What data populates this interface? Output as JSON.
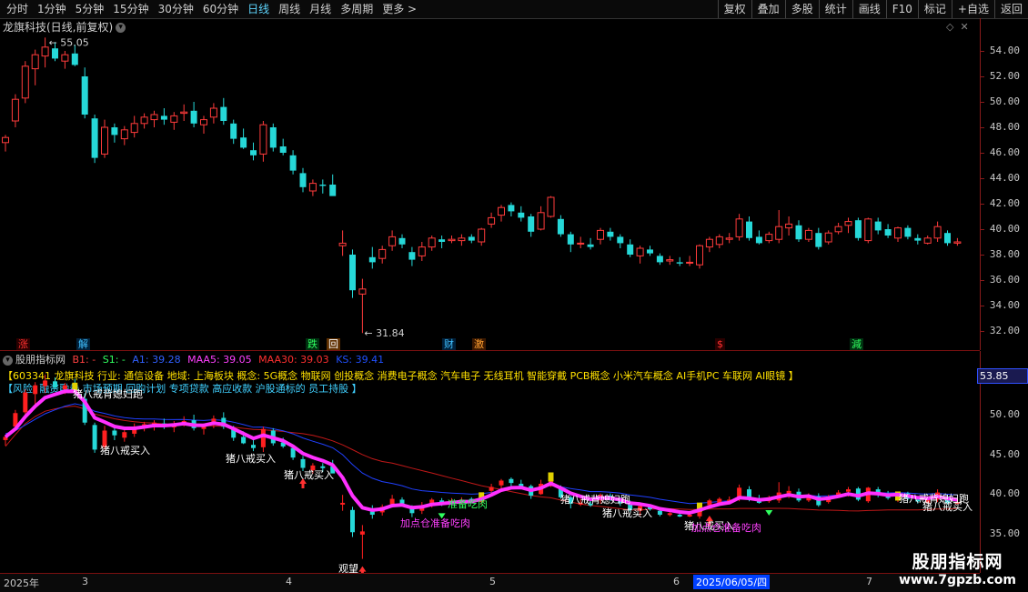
{
  "toolbar": {
    "periods": [
      "分时",
      "1分钟",
      "5分钟",
      "15分钟",
      "30分钟",
      "60分钟",
      "日线",
      "周线",
      "月线",
      "多周期",
      "更多"
    ],
    "active": "日线",
    "more_arrow": ">",
    "actions": [
      "复权",
      "叠加",
      "多股",
      "统计",
      "画线",
      "F10",
      "标记",
      "+自选",
      "返回"
    ]
  },
  "main": {
    "title": "龙旗科技(日线,前复权)",
    "high_label": "55.05",
    "low_label": "31.84",
    "yaxis": [
      "54.00",
      "52.00",
      "50.00",
      "48.00",
      "46.00",
      "44.00",
      "42.00",
      "40.00",
      "38.00",
      "36.00",
      "34.00",
      "32.00"
    ],
    "tags": [
      {
        "text": "涨",
        "color": "#ff3030",
        "bg": "#2a0000"
      },
      {
        "text": "解",
        "color": "#40c0ff",
        "bg": "#00203a"
      },
      {
        "text": "跌",
        "color": "#30ff60",
        "bg": "#003010"
      },
      {
        "text": "回",
        "color": "#ffffff",
        "bg": "#603000"
      },
      {
        "text": "财",
        "color": "#40c0ff",
        "bg": "#00203a"
      },
      {
        "text": "激",
        "color": "#ffa030",
        "bg": "#3a1800"
      },
      {
        "text": "$",
        "color": "#ff3030",
        "bg": "#2a0000"
      },
      {
        "text": "減",
        "color": "#30ff60",
        "bg": "#003010"
      }
    ],
    "ohlc": [
      [
        46.8,
        47.4,
        46.1,
        47.2
      ],
      [
        48.5,
        50.6,
        48.0,
        50.2
      ],
      [
        50.3,
        53.2,
        49.9,
        52.8
      ],
      [
        52.6,
        54.1,
        51.3,
        53.7
      ],
      [
        53.6,
        55.05,
        52.7,
        54.3
      ],
      [
        54.2,
        54.7,
        53.2,
        53.4
      ],
      [
        53.2,
        54.0,
        52.6,
        53.7
      ],
      [
        53.8,
        54.5,
        52.8,
        52.9
      ],
      [
        52.0,
        52.7,
        48.7,
        49.0
      ],
      [
        48.7,
        49.0,
        45.2,
        45.6
      ],
      [
        45.9,
        48.6,
        45.6,
        48.0
      ],
      [
        48.0,
        48.3,
        46.8,
        47.4
      ],
      [
        47.1,
        48.1,
        46.6,
        47.8
      ],
      [
        47.6,
        48.9,
        47.2,
        48.3
      ],
      [
        48.3,
        49.1,
        47.9,
        48.8
      ],
      [
        48.6,
        49.3,
        48.0,
        49.0
      ],
      [
        48.9,
        49.5,
        48.2,
        48.6
      ],
      [
        48.4,
        49.2,
        47.8,
        48.9
      ],
      [
        49.1,
        49.8,
        48.5,
        49.2
      ],
      [
        49.3,
        50.0,
        48.0,
        48.3
      ],
      [
        48.2,
        48.9,
        47.5,
        48.6
      ],
      [
        48.8,
        49.9,
        48.3,
        49.5
      ],
      [
        49.6,
        50.3,
        48.2,
        48.5
      ],
      [
        48.3,
        48.6,
        46.7,
        47.1
      ],
      [
        47.2,
        47.9,
        46.3,
        46.4
      ],
      [
        46.2,
        46.8,
        45.4,
        45.8
      ],
      [
        45.9,
        48.5,
        45.3,
        48.2
      ],
      [
        48.0,
        48.3,
        46.1,
        46.4
      ],
      [
        46.5,
        47.1,
        45.8,
        46.0
      ],
      [
        45.8,
        46.2,
        44.3,
        44.6
      ],
      [
        44.4,
        44.8,
        42.9,
        43.3
      ],
      [
        43.0,
        43.9,
        42.6,
        43.6
      ],
      [
        43.5,
        43.9,
        42.8,
        43.4
      ],
      [
        43.5,
        44.3,
        42.9,
        42.6
      ],
      [
        38.7,
        39.9,
        37.9,
        38.9
      ],
      [
        38.0,
        38.4,
        34.6,
        35.2
      ],
      [
        34.9,
        36.1,
        31.84,
        35.3
      ],
      [
        37.8,
        38.6,
        36.9,
        37.4
      ],
      [
        37.7,
        38.7,
        37.3,
        38.4
      ],
      [
        38.7,
        39.9,
        38.3,
        39.4
      ],
      [
        39.3,
        39.6,
        38.5,
        38.8
      ],
      [
        38.2,
        38.6,
        37.1,
        37.6
      ],
      [
        37.9,
        39.0,
        37.5,
        38.6
      ],
      [
        38.6,
        39.5,
        38.3,
        39.3
      ],
      [
        39.2,
        39.5,
        38.5,
        39.0
      ],
      [
        39.1,
        39.5,
        38.9,
        39.2
      ],
      [
        39.1,
        39.6,
        38.7,
        39.3
      ],
      [
        39.4,
        39.6,
        38.9,
        39.1
      ],
      [
        39.0,
        40.1,
        38.7,
        40.0
      ],
      [
        40.4,
        41.3,
        40.1,
        40.9
      ],
      [
        41.1,
        41.9,
        40.6,
        41.7
      ],
      [
        41.9,
        42.1,
        41.0,
        41.4
      ],
      [
        41.3,
        41.8,
        40.6,
        40.9
      ],
      [
        41.0,
        41.2,
        39.4,
        39.8
      ],
      [
        40.0,
        41.8,
        39.9,
        41.3
      ],
      [
        41.0,
        42.6,
        40.9,
        42.5
      ],
      [
        40.8,
        41.1,
        39.4,
        39.6
      ],
      [
        39.6,
        39.8,
        38.2,
        38.8
      ],
      [
        38.9,
        39.4,
        38.5,
        38.9
      ],
      [
        38.8,
        39.3,
        38.4,
        38.6
      ],
      [
        39.2,
        40.1,
        38.8,
        39.9
      ],
      [
        39.8,
        40.1,
        39.1,
        39.4
      ],
      [
        39.4,
        39.6,
        38.5,
        38.9
      ],
      [
        38.8,
        39.2,
        37.8,
        38.0
      ],
      [
        37.9,
        38.7,
        37.3,
        38.5
      ],
      [
        38.4,
        38.7,
        37.9,
        38.1
      ],
      [
        37.9,
        38.1,
        37.2,
        37.4
      ],
      [
        37.5,
        37.9,
        37.2,
        37.6
      ],
      [
        37.4,
        37.8,
        37.1,
        37.3
      ],
      [
        37.4,
        37.9,
        37.1,
        37.4
      ],
      [
        37.2,
        38.8,
        36.9,
        38.7
      ],
      [
        38.6,
        39.4,
        38.2,
        39.2
      ],
      [
        38.8,
        39.6,
        38.5,
        39.4
      ],
      [
        39.2,
        39.7,
        38.9,
        39.3
      ],
      [
        39.4,
        41.2,
        39.1,
        40.8
      ],
      [
        40.6,
        41.0,
        39.1,
        39.3
      ],
      [
        39.4,
        39.9,
        38.8,
        38.9
      ],
      [
        39.1,
        39.8,
        38.9,
        39.6
      ],
      [
        39.2,
        41.5,
        38.9,
        40.2
      ],
      [
        40.1,
        41.0,
        39.5,
        40.4
      ],
      [
        40.3,
        40.7,
        39.0,
        39.2
      ],
      [
        39.2,
        40.1,
        39.0,
        39.9
      ],
      [
        39.7,
        40.1,
        38.4,
        38.6
      ],
      [
        39.0,
        39.9,
        38.8,
        39.7
      ],
      [
        39.8,
        40.5,
        39.6,
        40.2
      ],
      [
        40.3,
        40.9,
        39.7,
        40.6
      ],
      [
        40.7,
        40.9,
        39.1,
        39.3
      ],
      [
        39.1,
        40.9,
        38.9,
        40.8
      ],
      [
        40.6,
        40.9,
        39.6,
        39.9
      ],
      [
        40.0,
        40.4,
        39.3,
        39.5
      ],
      [
        39.3,
        40.2,
        39.0,
        40.1
      ],
      [
        40.1,
        40.3,
        39.2,
        39.4
      ],
      [
        39.3,
        39.6,
        38.8,
        39.1
      ],
      [
        38.9,
        39.5,
        38.8,
        39.3
      ],
      [
        39.3,
        40.6,
        39.0,
        40.2
      ],
      [
        39.7,
        39.9,
        38.7,
        38.9
      ],
      [
        38.9,
        39.3,
        38.7,
        39.0
      ]
    ]
  },
  "indicator": {
    "name": "股朋指标网",
    "b1": "B1: -",
    "s1": "S1: -",
    "a1": "A1: 39.28",
    "maa5": "MAA5: 39.05",
    "maa30": "MAA30: 39.03",
    "ks": "KS: 39.41",
    "info_line1": "【603341 龙旗科技 行业: 通信设备 地域: 上海板块 概念: 5G概念 物联网 创投概念 消费电子概念 汽车电子 无线耳机 智能穿戴 PCB概念 小米汽车概念 AI手机PC 车联网 AI眼镜 】",
    "info_line2": "【风险: 融资融券 市场预期 回购计划 专项贷款 高应收款 沪股通标的 员工持股 】",
    "price_tag": "53.85",
    "yaxis": [
      "50.00",
      "45.00",
      "40.00",
      "35.00"
    ],
    "labels": [
      {
        "text": "猪八戒背媳妇跑",
        "color": "#ffffff"
      },
      {
        "text": "猪八戒买入",
        "color": "#ffffff"
      },
      {
        "text": "猪八戒买入",
        "color": "#ffffff"
      },
      {
        "text": "猪八戒买入",
        "color": "#ffffff"
      },
      {
        "text": "加点仓准备吃肉",
        "color": "#ff40ff"
      },
      {
        "text": "准备吃肉",
        "color": "#30ff60"
      },
      {
        "text": "猪八戒背媳妇跑",
        "color": "#ffffff"
      },
      {
        "text": "猪八戒买入",
        "color": "#ffffff"
      },
      {
        "text": "猪八戒买入",
        "color": "#ffffff"
      },
      {
        "text": "加点仓准备吃肉",
        "color": "#ff40ff"
      },
      {
        "text": "猪八戒背媳妇跑",
        "color": "#ffffff"
      },
      {
        "text": "猪八戒买入",
        "color": "#ffffff"
      },
      {
        "text": "观望",
        "color": "#ffffff"
      }
    ]
  },
  "dates": {
    "labels": [
      "2025年",
      "3",
      "4",
      "5",
      "6",
      "2025/06/05/四",
      "7"
    ]
  },
  "watermark": {
    "line1": "股朋指标网",
    "line2": "www.7gpzb.com"
  },
  "colors": {
    "up": "#ff3b3b",
    "down": "#26d8d8",
    "ma_blue": "#2040ff",
    "ma_red": "#c01818",
    "ks": "#ff30ff",
    "accent": "#5fd7ff"
  }
}
